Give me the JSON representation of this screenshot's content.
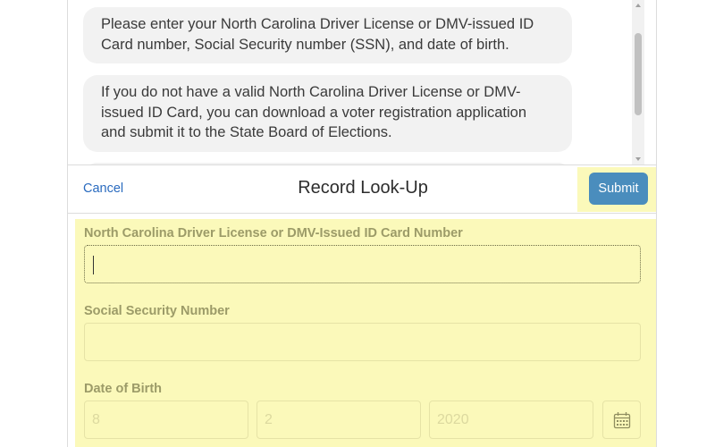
{
  "chat": {
    "messages": [
      "Please enter your North Carolina Driver License or DMV-issued ID Card number, Social Security number (SSN), and date of birth.",
      "If you do not have a valid North Carolina Driver License or DMV-issued ID Card, you can download a voter registration application and submit it to the State Board of Elections."
    ]
  },
  "header": {
    "cancel_label": "Cancel",
    "title": "Record Look-Up",
    "submit_label": "Submit"
  },
  "form": {
    "license_label": "North Carolina Driver License or DMV-Issued ID Card Number",
    "license_value": "",
    "ssn_label": "Social Security Number",
    "ssn_value": "",
    "dob_label": "Date of Birth",
    "dob_month_placeholder": "8",
    "dob_day_placeholder": "2",
    "dob_year_placeholder": "2020",
    "calendar_icon": "calendar-icon"
  },
  "colors": {
    "accent": "#4a8dbd",
    "link": "#2a6bbf",
    "highlight": "#fbf9ba",
    "label": "#9c9b68"
  }
}
